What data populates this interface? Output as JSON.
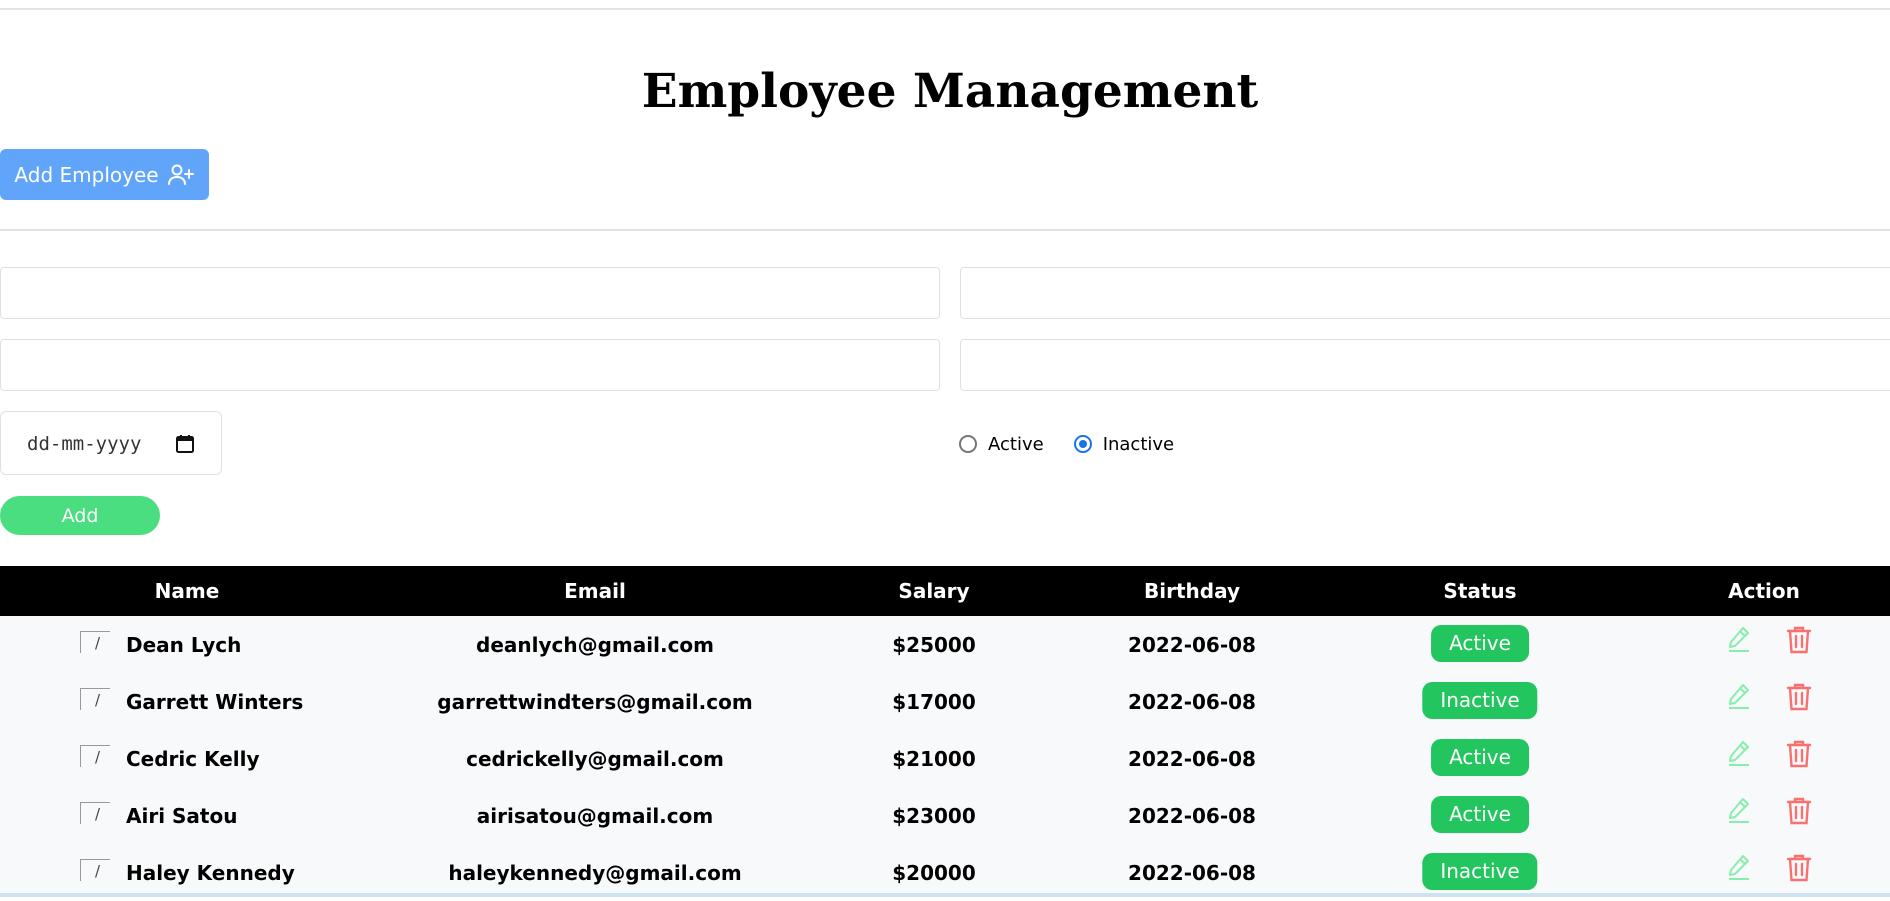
{
  "page": {
    "title": "Employee Management"
  },
  "toolbar": {
    "add_employee_label": "Add Employee",
    "add_employee_icon": "user-plus-icon"
  },
  "form": {
    "date_placeholder": "dd-mm-yyyy",
    "status_options": [
      {
        "label": "Active",
        "checked": false
      },
      {
        "label": "Inactive",
        "checked": true
      }
    ],
    "submit_label": "Add"
  },
  "table": {
    "columns": [
      "Name",
      "Email",
      "Salary",
      "Birthday",
      "Status",
      "Action"
    ],
    "image_alt": "/",
    "rows": [
      {
        "name": "Dean Lych",
        "email": "deanlych@gmail.com",
        "salary": "$25000",
        "birthday": "2022-06-08",
        "status": "Active"
      },
      {
        "name": "Garrett Winters",
        "email": "garrettwindters@gmail.com",
        "salary": "$17000",
        "birthday": "2022-06-08",
        "status": "Inactive"
      },
      {
        "name": "Cedric Kelly",
        "email": "cedrickelly@gmail.com",
        "salary": "$21000",
        "birthday": "2022-06-08",
        "status": "Active"
      },
      {
        "name": "Airi Satou",
        "email": "airisatou@gmail.com",
        "salary": "$23000",
        "birthday": "2022-06-08",
        "status": "Active"
      },
      {
        "name": "Haley Kennedy",
        "email": "haleykennedy@gmail.com",
        "salary": "$20000",
        "birthday": "2022-06-08",
        "status": "Inactive"
      }
    ]
  },
  "colors": {
    "primary_button": "#60a5fa",
    "add_button": "#4ade80",
    "status_badge": "#22c55e",
    "edit_icon": "#86efac",
    "delete_icon": "#f87171",
    "table_header": "#000000"
  }
}
